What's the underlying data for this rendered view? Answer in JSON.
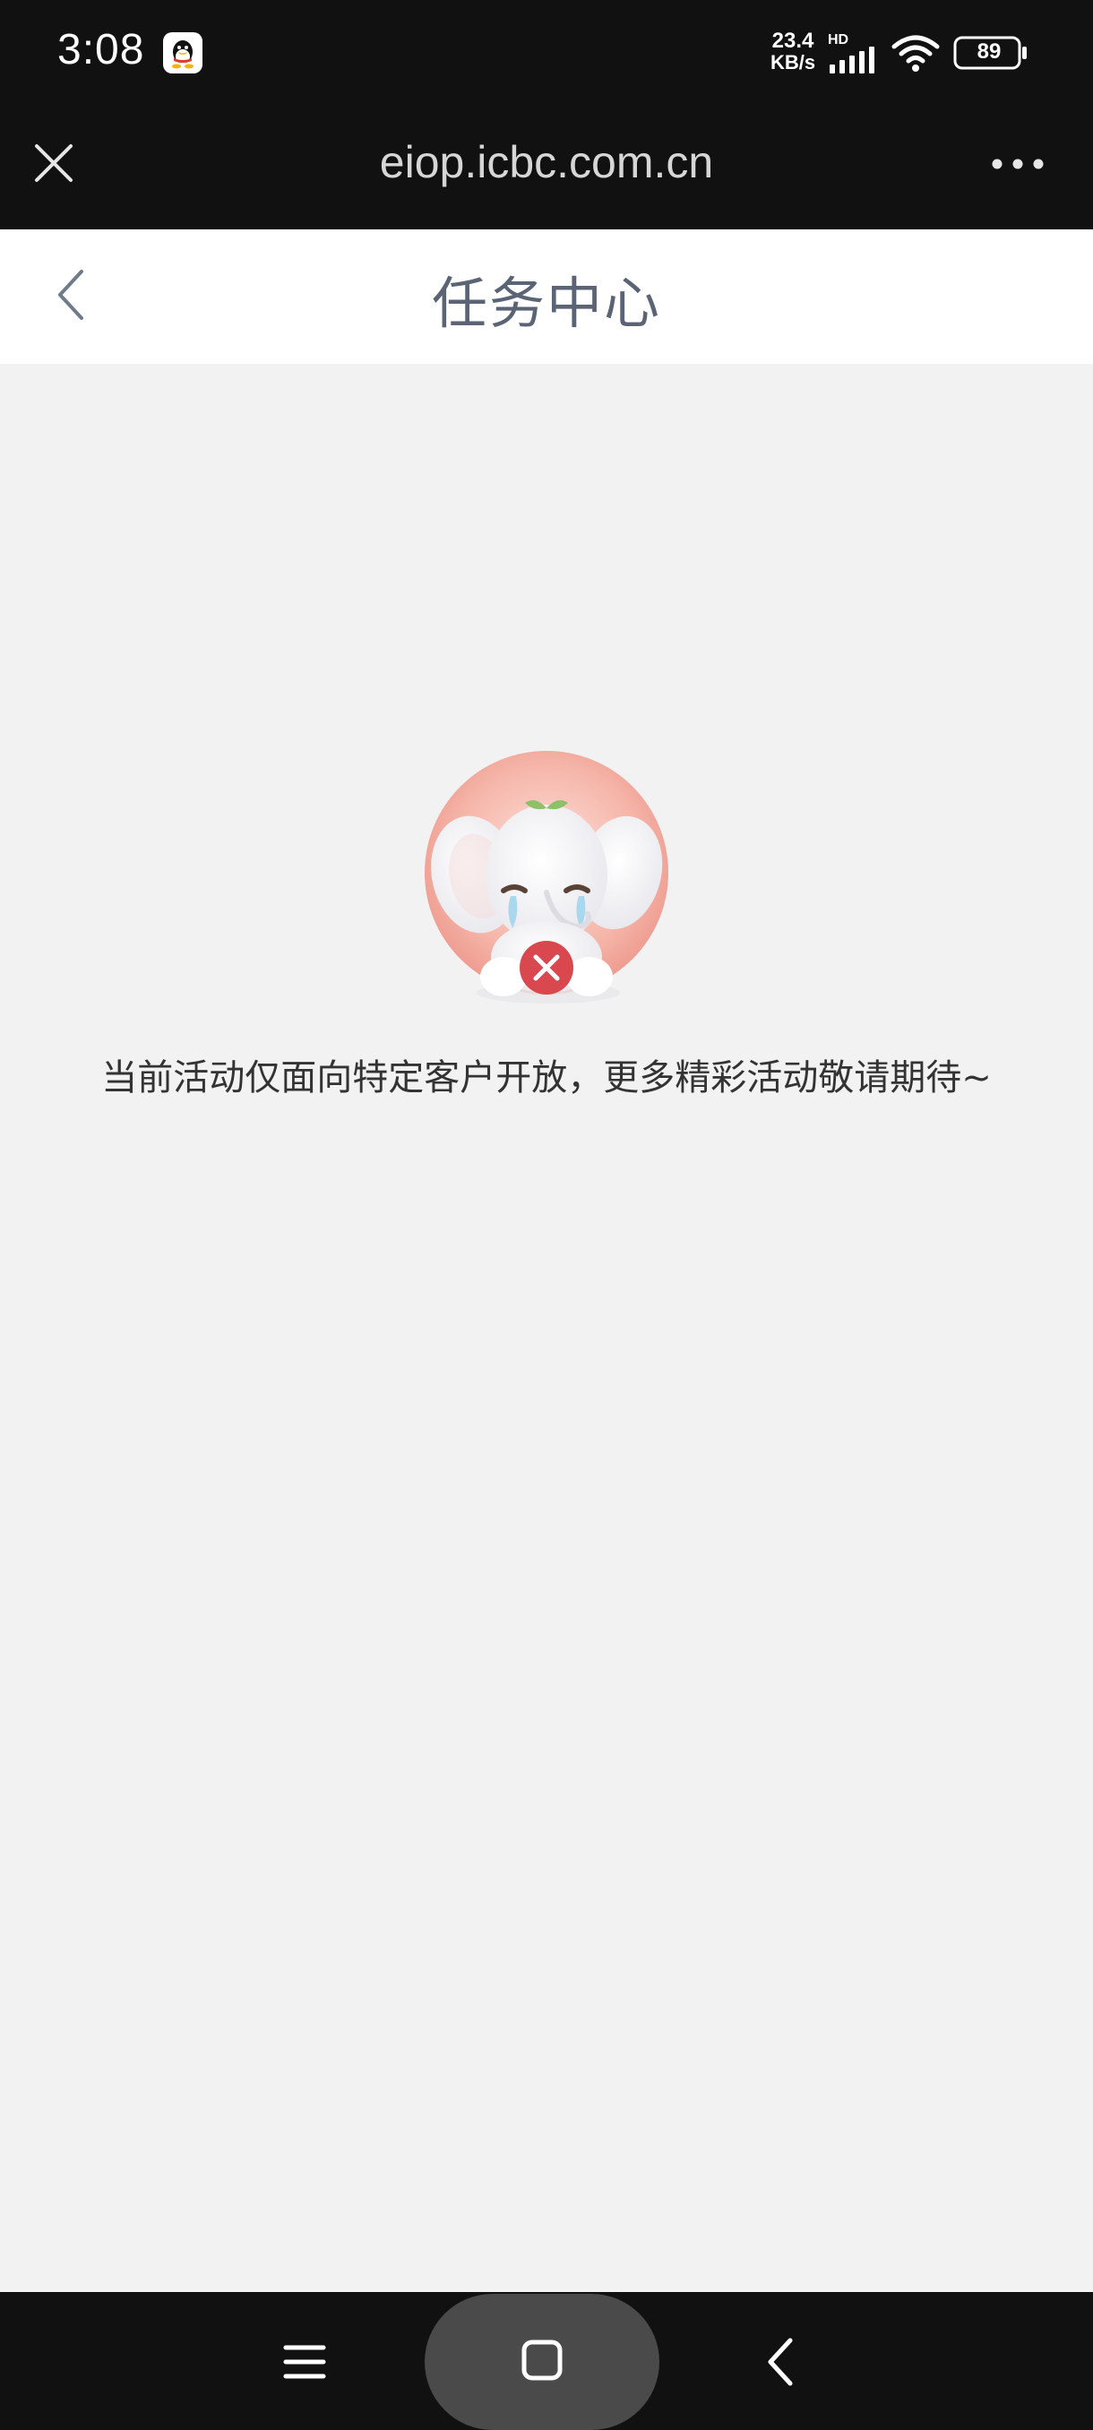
{
  "status_bar": {
    "time": "3:08",
    "net_speed_value": "23.4",
    "net_speed_unit": "KB/s",
    "network_label": "HD",
    "battery": "89",
    "icons": [
      "qq-notification-icon",
      "signal-icon",
      "wifi-icon",
      "battery-icon"
    ]
  },
  "browser": {
    "url": "eiop.icbc.com.cn",
    "close_icon": "close-icon",
    "more_icon": "more-icon"
  },
  "header": {
    "title": "任务中心",
    "back_icon": "chevron-left-icon"
  },
  "main": {
    "empty_message": "当前活动仅面向特定客户开放，更多精彩活动敬请期待~",
    "illustration": "crying-elephant-illustration"
  },
  "nav_bar": {
    "icons": [
      "menu-icon",
      "home-icon",
      "back-icon"
    ]
  },
  "colors": {
    "status_bar_bg": "#111111",
    "page_bg": "#f2f2f2",
    "header_bg": "#ffffff",
    "title_color": "#5b6475",
    "illustration_circle": "#f2a79c",
    "error_badge": "#d9484e"
  }
}
